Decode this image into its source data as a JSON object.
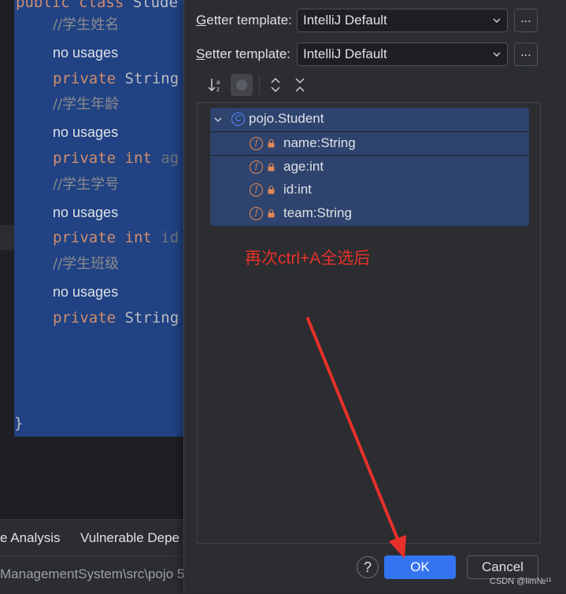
{
  "editor": {
    "lines": [
      {
        "kw": "public class ",
        "ty": "Stude"
      },
      {
        "comment": "//学生姓名"
      },
      {
        "usage": "no usages"
      },
      {
        "kw": "private ",
        "ty": "String"
      },
      {
        "comment": "//学生年龄"
      },
      {
        "usage": "no usages"
      },
      {
        "kw": "private int ",
        "dim": "ag"
      },
      {
        "comment": "//学生学号"
      },
      {
        "usage": "no usages"
      },
      {
        "kw": "private int ",
        "dim": "id"
      },
      {
        "comment": "//学生班级"
      },
      {
        "usage": "no usages"
      },
      {
        "kw": "private ",
        "ty": "String"
      },
      {
        "brace": "}"
      }
    ]
  },
  "tool_tabs": [
    "e Analysis",
    "Vulnerable Depe"
  ],
  "status": {
    "path": "ManagementSystem\\src\\pojo  5"
  },
  "dialog": {
    "getter": {
      "prefix": "G",
      "label": "etter template:",
      "value": "IntelliJ Default"
    },
    "setter": {
      "prefix": "S",
      "label": "etter template:",
      "value": "IntelliJ Default"
    },
    "more_label": "...",
    "tree": {
      "root_icon": "C",
      "root": "pojo.Student",
      "field_icon": "f",
      "fields": [
        "name:String",
        "age:int",
        "id:int",
        "team:String"
      ]
    },
    "annotation": "再次ctrl+A全选后",
    "help_label": "?",
    "ok_label": "OK",
    "cancel_label": "Cancel"
  },
  "watermark": "CSDN @lim№¹¹",
  "colors": {
    "selection": "#214283",
    "accent": "#3574f0",
    "annotation": "#e8312a"
  },
  "icons": [
    "sort-alpha-icon",
    "show-inherited-icon",
    "expand-all-icon",
    "collapse-all-icon",
    "class-icon",
    "field-icon",
    "lock-icon",
    "chevron-down-icon",
    "red-arrow"
  ]
}
